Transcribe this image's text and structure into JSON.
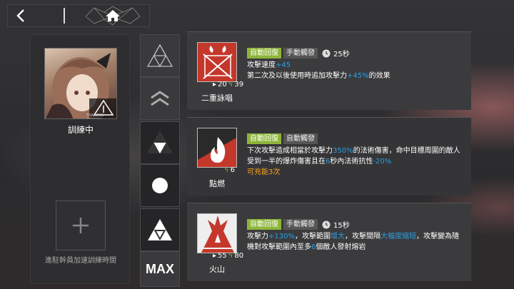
{
  "top": {
    "back_icon": "chevron-left-icon",
    "home_icon": "home-icon"
  },
  "operator": {
    "status": "訓練中",
    "portrait_caption": "TRAINING SESSION",
    "add_hint": "進駐幹員加速訓練時間"
  },
  "levels": [
    {
      "name": "rank-1"
    },
    {
      "name": "rank-2"
    },
    {
      "name": "rank-3"
    },
    {
      "name": "rank-4"
    },
    {
      "name": "rank-5"
    },
    {
      "name": "MAX",
      "label": "MAX"
    }
  ],
  "skills": [
    {
      "name": "二重詠唱",
      "tag_recovery": "自動回復",
      "tag_trigger": "手動觸發",
      "duration": "25秒",
      "sp_initial": "20",
      "sp_cost": "39",
      "line1_a": "攻擊速度",
      "line1_b": "+45",
      "line2_a": "第二次及以後使用時追加攻擊力",
      "line2_b": "+45%",
      "line2_c": "的效果"
    },
    {
      "name": "點燃",
      "tag_recovery": "自動回復",
      "tag_trigger": "自動觸發",
      "sp_cost": "6",
      "d1": "下次攻擊造成相當於攻擊力",
      "d2": "350%",
      "d3": "的法術傷害，命中目標周圍的敵人受到一半的爆炸傷害且在",
      "d4": "6",
      "d5": "秒內法術抗性",
      "d6": "-20%",
      "charge": "可充能3次"
    },
    {
      "name": "火山",
      "tag_recovery": "自動回復",
      "tag_trigger": "手動觸發",
      "duration": "15秒",
      "sp_initial": "55",
      "sp_cost": "80",
      "d1": "攻擊力",
      "d2": "+130%",
      "d3": "，攻擊範圍",
      "d4": "增大",
      "d5": "，攻擊間隔",
      "d6": "大幅度縮短",
      "d7": "，攻擊變為隨機對攻擊範圍內至多",
      "d8": "6",
      "d9": "個敵人發射熔岩"
    }
  ],
  "colors": {
    "accent_green": "#8db53a",
    "blue": "#2a9ee0",
    "orange": "#f7a31c"
  }
}
